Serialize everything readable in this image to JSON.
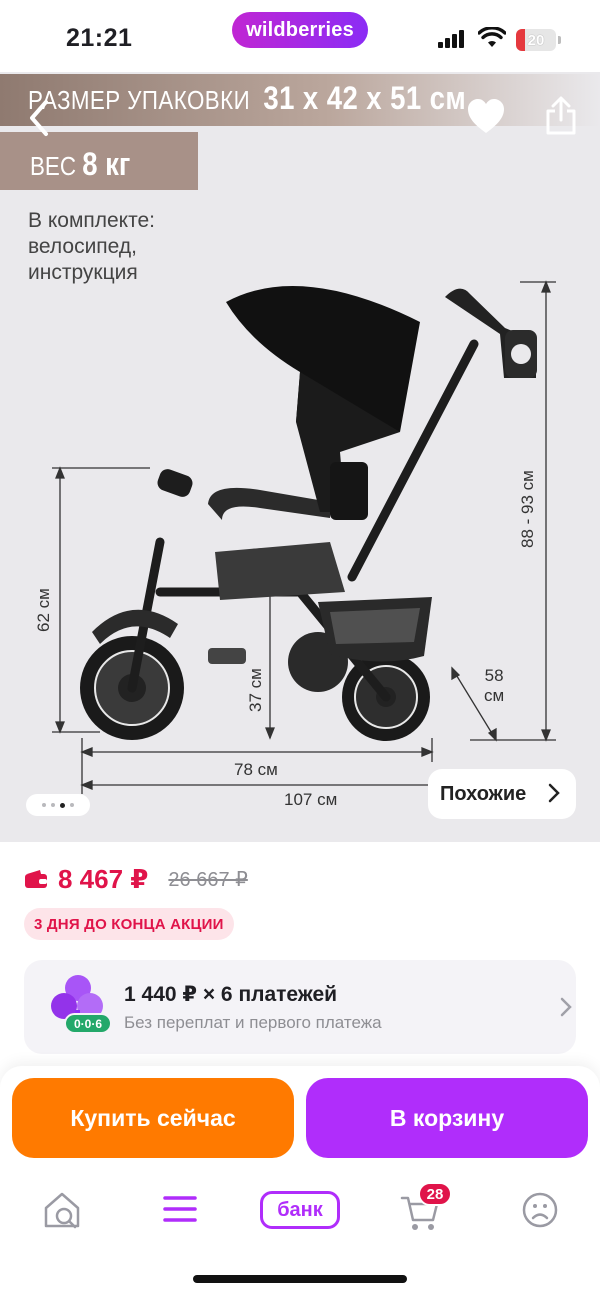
{
  "status_bar": {
    "time": "21:21",
    "brand": "wildberries",
    "battery_level": "20",
    "icons": [
      "signal-icon",
      "wifi-icon",
      "battery-icon"
    ]
  },
  "gallery": {
    "package_size_label": "РАЗМЕР УПАКОВКИ",
    "package_size_value": "31 х 42 х 51 см",
    "weight_label": "ВЕС",
    "weight_value": "8 кг",
    "kit_text": "В комплекте: велосипед, инструкция",
    "dimensions": {
      "height_62": "62 см",
      "height_37": "37 см",
      "height_handle": "88 - 93 см",
      "depth_58_a": "58",
      "depth_58_b": "см",
      "length_78": "78 см",
      "length_107": "107 см"
    },
    "page_count": 4,
    "active_page": 2,
    "similar_label": "Похожие"
  },
  "product": {
    "price": "8 467 ₽",
    "old_price": "26 667 ₽",
    "promo": "3 ДНЯ ДО КОНЦА АКЦИИ",
    "split": {
      "title": "1 440 ₽ × 6 платежей",
      "subtitle": "Без переплат и первого платежа",
      "badge": "0·0·6"
    }
  },
  "actions": {
    "buy_now": "Купить сейчас",
    "add_to_cart": "В корзину"
  },
  "tab_bar": {
    "bank_label": "банк",
    "cart_count": "28"
  },
  "colors": {
    "accent_purple": "#b02dfb",
    "accent_orange": "#ff7a00",
    "price_red": "#e0144a"
  }
}
